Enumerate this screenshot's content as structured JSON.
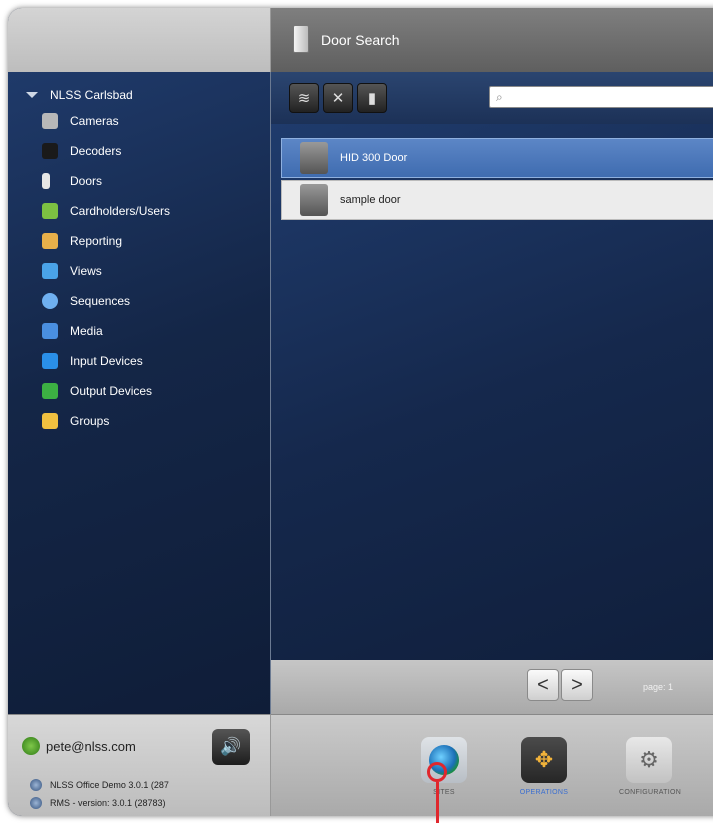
{
  "header": {
    "title": "Door Search"
  },
  "sidebar": {
    "site": "NLSS Carlsbad",
    "items": [
      {
        "label": "Cameras",
        "icon": "camera-icon",
        "color": "#b8b8b8"
      },
      {
        "label": "Decoders",
        "icon": "decoder-icon",
        "color": "#1a1a1a"
      },
      {
        "label": "Doors",
        "icon": "door-icon",
        "color": "#e6e6e6"
      },
      {
        "label": "Cardholders/Users",
        "icon": "cardholders-icon",
        "color": "#7cc142"
      },
      {
        "label": "Reporting",
        "icon": "reporting-icon",
        "color": "#e8b04a"
      },
      {
        "label": "Views",
        "icon": "views-icon",
        "color": "#4aa3e8"
      },
      {
        "label": "Sequences",
        "icon": "sequences-icon",
        "color": "#6fb0f0"
      },
      {
        "label": "Media",
        "icon": "media-icon",
        "color": "#4a8fe0"
      },
      {
        "label": "Input Devices",
        "icon": "input-devices-icon",
        "color": "#2a8fe8"
      },
      {
        "label": "Output Devices",
        "icon": "output-devices-icon",
        "color": "#3cb043"
      },
      {
        "label": "Groups",
        "icon": "groups-icon",
        "color": "#f0c040"
      }
    ]
  },
  "toolbar": {
    "buttons": [
      "filter-icon",
      "tools-icon",
      "door-icon"
    ],
    "search_placeholder": ""
  },
  "doors": [
    {
      "name": "HID 300 Door",
      "selected": true
    },
    {
      "name": "sample door",
      "selected": false
    }
  ],
  "pager": {
    "prev": "<",
    "next": ">",
    "label": "page: 1"
  },
  "footer": {
    "user": "pete@nlss.com",
    "versions": [
      "NLSS Office Demo 3.0.1 (287",
      "RMS - version: 3.0.1 (28783)"
    ],
    "modes": [
      {
        "label": "SITES",
        "icon": "globe-icon"
      },
      {
        "label": "OPERATIONS",
        "icon": "operations-arrows-icon"
      },
      {
        "label": "CONFIGURATION",
        "icon": "gears-icon"
      }
    ]
  },
  "colors": {
    "accent": "#3f6cb0",
    "marker": "#e0272d"
  }
}
